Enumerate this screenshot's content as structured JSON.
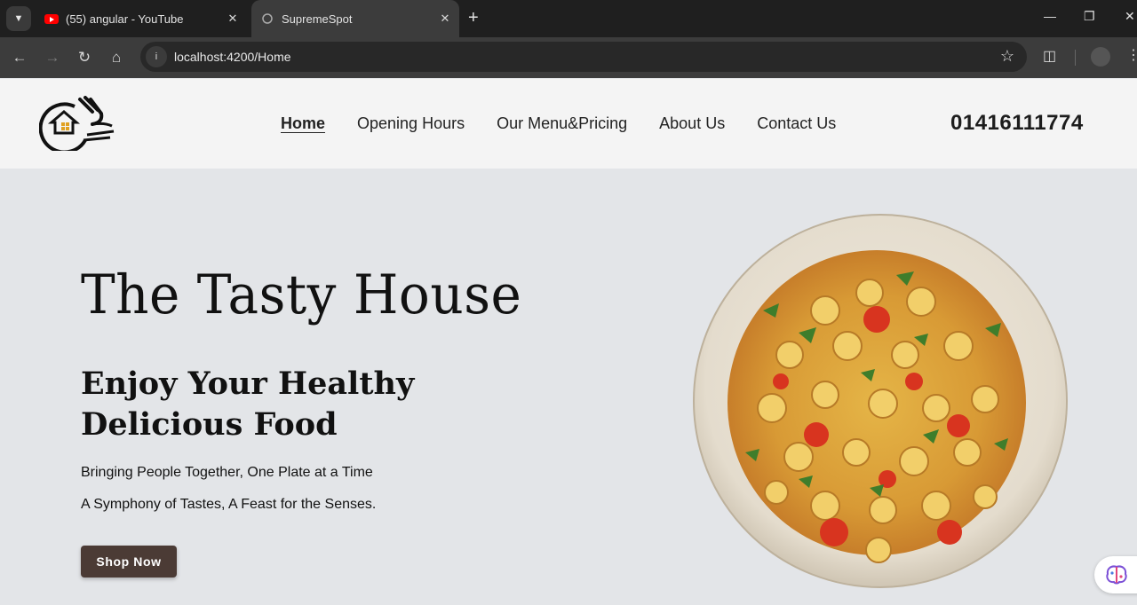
{
  "browser": {
    "tabs": [
      {
        "title": "(55) angular - YouTube",
        "active": false,
        "icon": "youtube-icon"
      },
      {
        "title": "SupremeSpot",
        "active": true,
        "icon": "globe-icon"
      }
    ],
    "url": "localhost:4200/Home"
  },
  "site": {
    "nav": [
      "Home",
      "Opening Hours",
      "Our Menu&Pricing",
      "About Us",
      "Contact Us"
    ],
    "active_nav": "Home",
    "phone": "01416111774"
  },
  "hero": {
    "title": "The Tasty House",
    "subtitle_line1": "Enjoy Your Healthy",
    "subtitle_line2": "Delicious Food",
    "tagline1": "Bringing People Together, One Plate at a Time",
    "tagline2": "A Symphony of Tastes, A Feast for the Senses.",
    "cta": "Shop Now"
  },
  "colors": {
    "header_bg": "#f4f4f4",
    "hero_bg": "#e3e5e8",
    "cta_bg": "#4b3b35",
    "logo_accent": "#e0a020"
  }
}
